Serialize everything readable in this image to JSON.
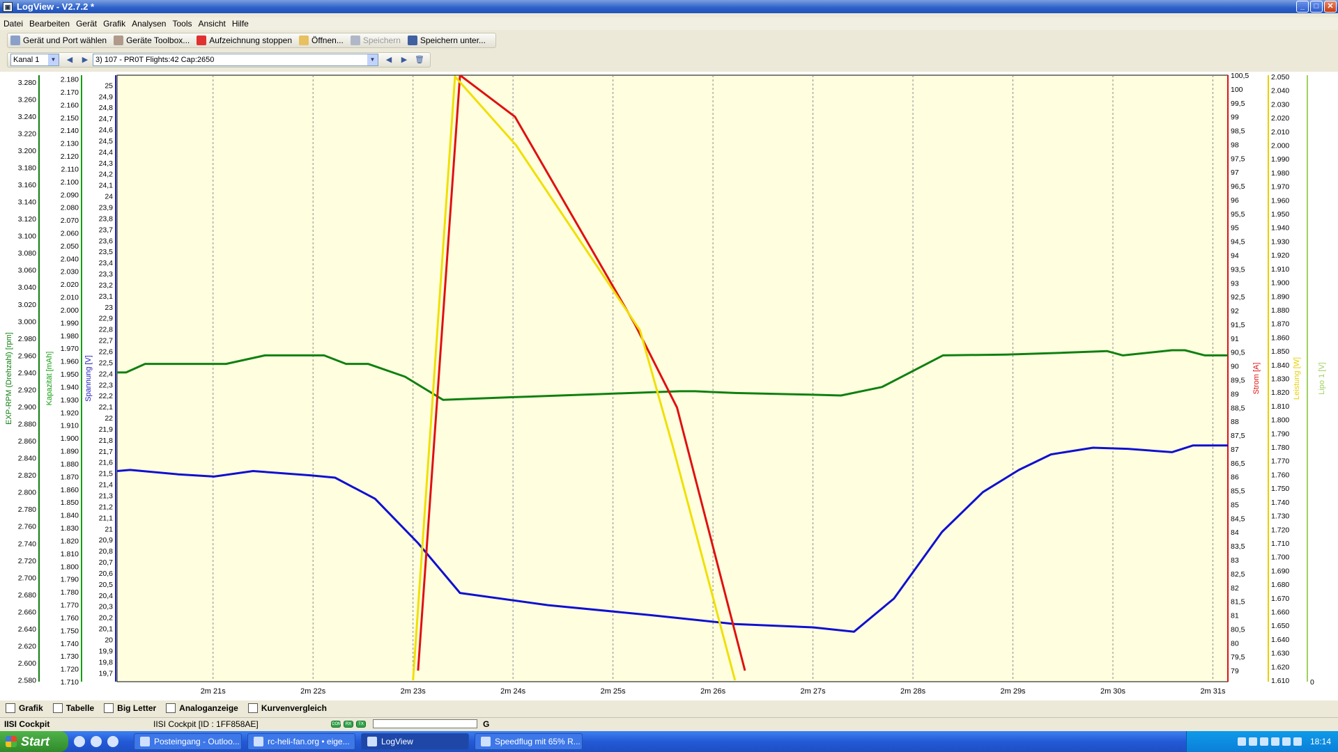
{
  "window": {
    "title": "LogView - V2.7.2 *"
  },
  "menu": [
    "Datei",
    "Bearbeiten",
    "Gerät",
    "Grafik",
    "Analysen",
    "Tools",
    "Ansicht",
    "Hilfe"
  ],
  "toolbar": {
    "select_device": "Gerät und Port wählen",
    "device_toolbox": "Geräte Toolbox...",
    "stop_recording": "Aufzeichnung stoppen",
    "open": "Öffnen...",
    "save": "Speichern",
    "save_as": "Speichern unter..."
  },
  "channel": {
    "selected": "Kanal 1",
    "flight": "3) 107 - PR0T  Flights:42  Cap:2650"
  },
  "bottom_tabs": [
    "Grafik",
    "Tabelle",
    "Big Letter",
    "Analoganzeige",
    "Kurvenvergleich"
  ],
  "status": {
    "device": "IISI Cockpit",
    "id": "IISI Cockpit [ID : 1FF858AE]",
    "leds": [
      "COM",
      "RX",
      "TX"
    ],
    "g_label": "G"
  },
  "taskbar": {
    "start": "Start",
    "items": [
      "Posteingang - Outloo...",
      "rc-heli-fan.org • eige...",
      "LogView",
      "Speedflug mit 65% R..."
    ],
    "clock": "18:14"
  },
  "chart_data": {
    "type": "line",
    "x_ticks": [
      "2m 21s",
      "2m 22s",
      "2m 23s",
      "2m 24s",
      "2m 25s",
      "2m 26s",
      "2m 27s",
      "2m 28s",
      "2m 29s",
      "2m 30s",
      "2m 31s"
    ],
    "xlim": [
      140.04,
      151.15
    ],
    "grid": true,
    "axes": [
      {
        "label": "EXP-RPM (Drehzahl) [rpm]",
        "color": "#108010",
        "side": "left",
        "ylim": [
          2578,
          3288
        ],
        "ticks": [
          "3.280",
          "3.260",
          "3.240",
          "3.220",
          "3.200",
          "3.180",
          "3.160",
          "3.140",
          "3.120",
          "3.100",
          "3.080",
          "3.060",
          "3.040",
          "3.020",
          "3.000",
          "2.980",
          "2.960",
          "2.940",
          "2.920",
          "2.900",
          "2.880",
          "2.860",
          "2.840",
          "2.820",
          "2.800",
          "2.780",
          "2.760",
          "2.740",
          "2.720",
          "2.700",
          "2.680",
          "2.660",
          "2.640",
          "2.620",
          "2.600",
          "2.580"
        ]
      },
      {
        "label": "Kapazität [mAh]",
        "color": "#10a010",
        "side": "left",
        "ylim": [
          1710,
          2183
        ],
        "ticks": [
          "2.180",
          "2.170",
          "2.160",
          "2.150",
          "2.140",
          "2.130",
          "2.120",
          "2.110",
          "2.100",
          "2.090",
          "2.080",
          "2.070",
          "2.060",
          "2.050",
          "2.040",
          "2.030",
          "2.020",
          "2.010",
          "2.000",
          "1.990",
          "1.980",
          "1.970",
          "1.960",
          "1.950",
          "1.940",
          "1.930",
          "1.920",
          "1.910",
          "1.900",
          "1.890",
          "1.880",
          "1.870",
          "1.860",
          "1.850",
          "1.840",
          "1.830",
          "1.820",
          "1.810",
          "1.800",
          "1.790",
          "1.780",
          "1.770",
          "1.760",
          "1.750",
          "1.740",
          "1.730",
          "1.720",
          "1.710"
        ]
      },
      {
        "label": "Spannung [V]",
        "color": "#2020c0",
        "side": "left",
        "ylim": [
          19.62,
          25.09
        ],
        "ticks": [
          "25",
          "24,9",
          "24,8",
          "24,7",
          "24,6",
          "24,5",
          "24,4",
          "24,3",
          "24,2",
          "24,1",
          "24",
          "23,9",
          "23,8",
          "23,7",
          "23,6",
          "23,5",
          "23,4",
          "23,3",
          "23,2",
          "23,1",
          "23",
          "22,9",
          "22,8",
          "22,7",
          "22,6",
          "22,5",
          "22,4",
          "22,3",
          "22,2",
          "22,1",
          "22",
          "21,9",
          "21,8",
          "21,7",
          "21,6",
          "21,5",
          "21,4",
          "21,3",
          "21,2",
          "21,1",
          "21",
          "20,9",
          "20,8",
          "20,7",
          "20,6",
          "20,5",
          "20,4",
          "20,3",
          "20,2",
          "20,1",
          "20",
          "19,9",
          "19,8",
          "19,7"
        ]
      },
      {
        "label": "Strom [A]",
        "color": "#e01010",
        "side": "right",
        "ylim": [
          78.6,
          100.5
        ],
        "ticks": [
          "100,5",
          "100",
          "99,5",
          "99",
          "98,5",
          "98",
          "97,5",
          "97",
          "96,5",
          "96",
          "95,5",
          "95",
          "94,5",
          "94",
          "93,5",
          "93",
          "92,5",
          "92",
          "91,5",
          "91",
          "90,5",
          "90",
          "89,5",
          "89",
          "88,5",
          "88",
          "87,5",
          "87",
          "86,5",
          "86",
          "85,5",
          "85",
          "84,5",
          "84",
          "83,5",
          "83",
          "82,5",
          "82",
          "81,5",
          "81",
          "80,5",
          "80",
          "79,5",
          "79"
        ]
      },
      {
        "label": "Leistung [W]",
        "color": "#e8d000",
        "side": "right",
        "ylim": [
          1609,
          2051
        ],
        "ticks": [
          "2.050",
          "2.040",
          "2.030",
          "2.020",
          "2.010",
          "2.000",
          "1.990",
          "1.980",
          "1.970",
          "1.960",
          "1.950",
          "1.940",
          "1.930",
          "1.920",
          "1.910",
          "1.900",
          "1.890",
          "1.880",
          "1.870",
          "1.860",
          "1.850",
          "1.840",
          "1.830",
          "1.820",
          "1.810",
          "1.800",
          "1.790",
          "1.780",
          "1.770",
          "1.760",
          "1.750",
          "1.740",
          "1.730",
          "1.720",
          "1.710",
          "1.700",
          "1.690",
          "1.680",
          "1.670",
          "1.660",
          "1.650",
          "1.640",
          "1.630",
          "1.620",
          "1.610"
        ]
      },
      {
        "label": "Lipo 1 [V]",
        "color": "#a0d060",
        "side": "right",
        "ylim": [
          0,
          0
        ],
        "ticks": [
          "0"
        ]
      }
    ],
    "series": [
      {
        "axis": 0,
        "color": "#108010",
        "x": [
          140.04,
          140.13,
          140.32,
          141.13,
          141.52,
          142.11,
          142.33,
          142.55,
          142.92,
          143.3,
          143.98,
          144.94,
          145.67,
          145.82,
          146.22,
          146.97,
          147.28,
          147.69,
          148.3,
          148.93,
          149.48,
          149.94,
          150.1,
          150.59,
          150.72,
          150.92,
          151.15
        ],
        "y": [
          2940,
          2940,
          2950,
          2950,
          2960,
          2960,
          2950,
          2950,
          2935,
          2908,
          2911,
          2915,
          2918,
          2918,
          2916,
          2914,
          2913,
          2923,
          2960,
          2961,
          2963,
          2965,
          2960,
          2966,
          2966,
          2960,
          2960
        ]
      },
      {
        "axis": 2,
        "color": "#1010d0",
        "x": [
          140.04,
          140.17,
          140.65,
          141.01,
          141.4,
          141.98,
          142.22,
          142.62,
          143.05,
          143.47,
          144.35,
          145.38,
          146.22,
          147.0,
          147.41,
          147.81,
          148.29,
          148.7,
          149.06,
          149.38,
          149.8,
          150.15,
          150.59,
          150.8,
          151.15
        ],
        "y": [
          21.52,
          21.53,
          21.49,
          21.47,
          21.52,
          21.48,
          21.46,
          21.27,
          20.87,
          20.42,
          20.31,
          20.22,
          20.14,
          20.11,
          20.07,
          20.37,
          20.97,
          21.33,
          21.53,
          21.67,
          21.73,
          21.72,
          21.69,
          21.75,
          21.75
        ]
      },
      {
        "axis": 3,
        "color": "#e01010",
        "x": [
          143.05,
          143.47,
          144.02,
          145.22,
          145.64,
          146.32
        ],
        "y": [
          79,
          100.5,
          99,
          91.5,
          88.5,
          79
        ]
      },
      {
        "axis": 4,
        "color": "#f0e000",
        "x": [
          143.0,
          143.42,
          144.03,
          145.27,
          145.6,
          146.22
        ],
        "y": [
          1610,
          2050,
          2000,
          1865,
          1780,
          1610
        ]
      }
    ]
  }
}
